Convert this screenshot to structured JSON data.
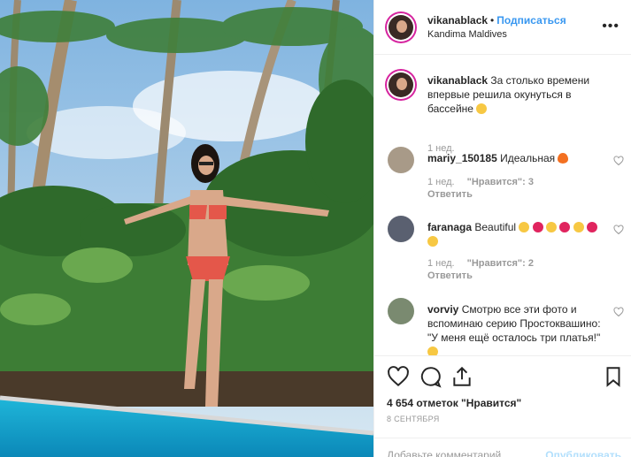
{
  "post": {
    "username": "vikanablack",
    "dot": "•",
    "follow_label": "Подписаться",
    "location": "Kandima Maldives",
    "more_icon": "more-icon"
  },
  "caption": {
    "username": "vikanablack",
    "text": "За столько времени впервые решила окунуться в бассейне",
    "emoji": "grinning-emoji",
    "time": "1 нед."
  },
  "comments": [
    {
      "username": "mariy_150185",
      "text": "Идеальная",
      "emoji": "fire-emoji",
      "time": "1 нед.",
      "likes": "\"Нравится\": 3",
      "reply": "Ответить"
    },
    {
      "username": "faranaga",
      "text": "Beautiful",
      "emoji": "heart-eyes-emoji",
      "time": "1 нед.",
      "likes": "\"Нравится\": 2",
      "reply": "Ответить"
    },
    {
      "username": "vorviy",
      "text": "Смотрю все эти фото и вспоминаю серию Простоквашино: \"У меня ещё осталось три платья!\"",
      "emoji": "smiling-emoji"
    }
  ],
  "actions": {
    "likes_count": "4 654 отметок \"Нравится\"",
    "date": "8 СЕНТЯБРЯ",
    "comment_placeholder": "Добавьте комментарий...",
    "post_label": "Опубликовать"
  },
  "colors": {
    "link_blue": "#3897f0",
    "muted": "#999999",
    "border": "#efefef",
    "post_disabled": "#b2dffc"
  }
}
